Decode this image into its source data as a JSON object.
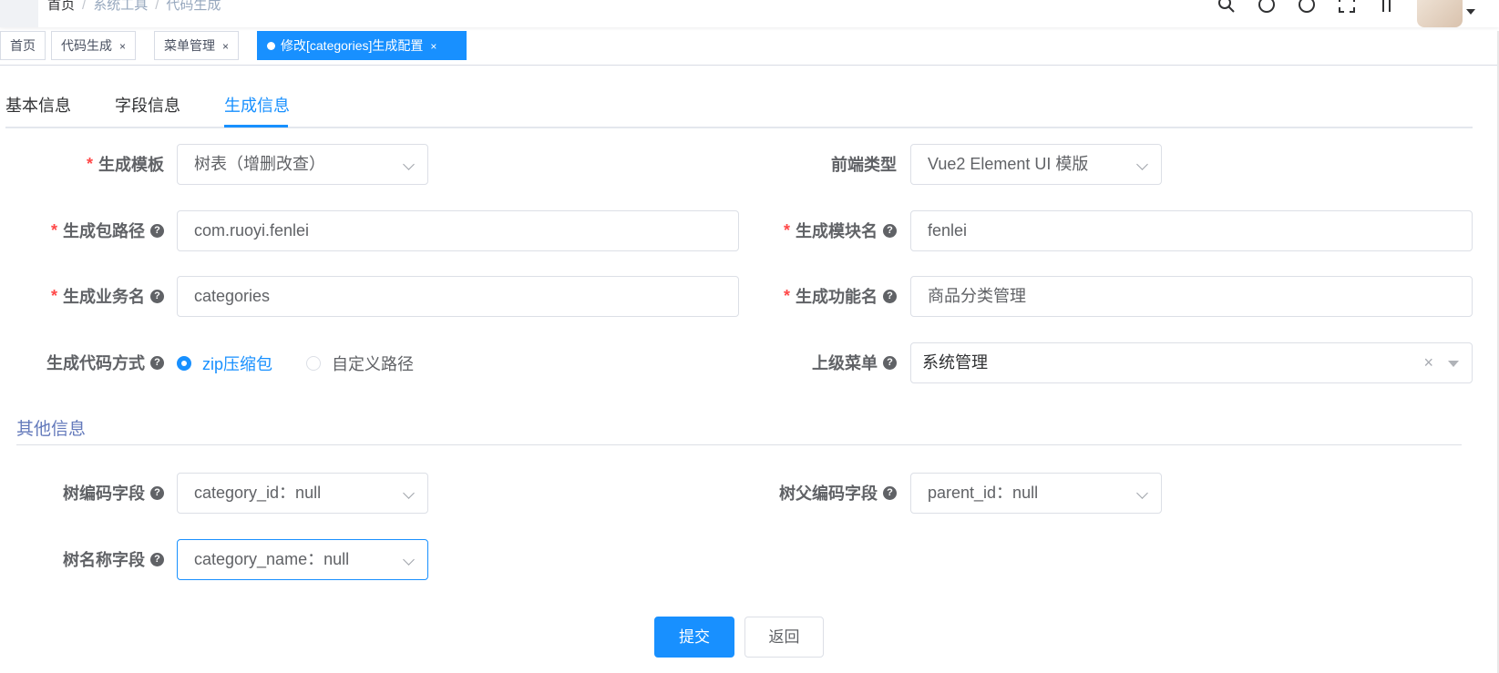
{
  "navbar": {
    "breadcrumb": [
      "首页",
      "系统工具",
      "代码生成"
    ],
    "separator": "/",
    "icons": [
      "search-icon",
      "github-icon",
      "question-icon",
      "fullscreen-icon",
      "font-size-icon"
    ]
  },
  "tags": [
    {
      "label": "首页",
      "closable": false
    },
    {
      "label": "代码生成",
      "closable": true
    },
    {
      "label": "菜单管理",
      "closable": true
    },
    {
      "label": "修改[categories]生成配置",
      "closable": true,
      "active": true
    }
  ],
  "close_glyph": "×",
  "tabs": [
    "基本信息",
    "字段信息",
    "生成信息"
  ],
  "active_tab": "生成信息",
  "form": {
    "template_label": "生成模板",
    "template_value": "树表（增删改查）",
    "frontend_label": "前端类型",
    "frontend_value": "Vue2 Element UI 模版",
    "package_label": "生成包路径",
    "package_value": "com.ruoyi.fenlei",
    "module_label": "生成模块名",
    "module_value": "fenlei",
    "business_label": "生成业务名",
    "business_value": "categories",
    "function_label": "生成功能名",
    "function_value": "商品分类管理",
    "gentype_label": "生成代码方式",
    "gentype_options": [
      "zip压缩包",
      "自定义路径"
    ],
    "gentype_selected": "zip压缩包",
    "parent_menu_label": "上级菜单",
    "parent_menu_value": "系统管理"
  },
  "other": {
    "section_title": "其他信息",
    "tree_code_label": "树编码字段",
    "tree_code_value": "category_id：null",
    "tree_parent_label": "树父编码字段",
    "tree_parent_value": "parent_id：null",
    "tree_name_label": "树名称字段",
    "tree_name_value": "category_name：null"
  },
  "buttons": {
    "submit": "提交",
    "back": "返回"
  },
  "colors": {
    "primary": "#1890ff",
    "required": "#ff4949",
    "section": "#6379bb"
  }
}
